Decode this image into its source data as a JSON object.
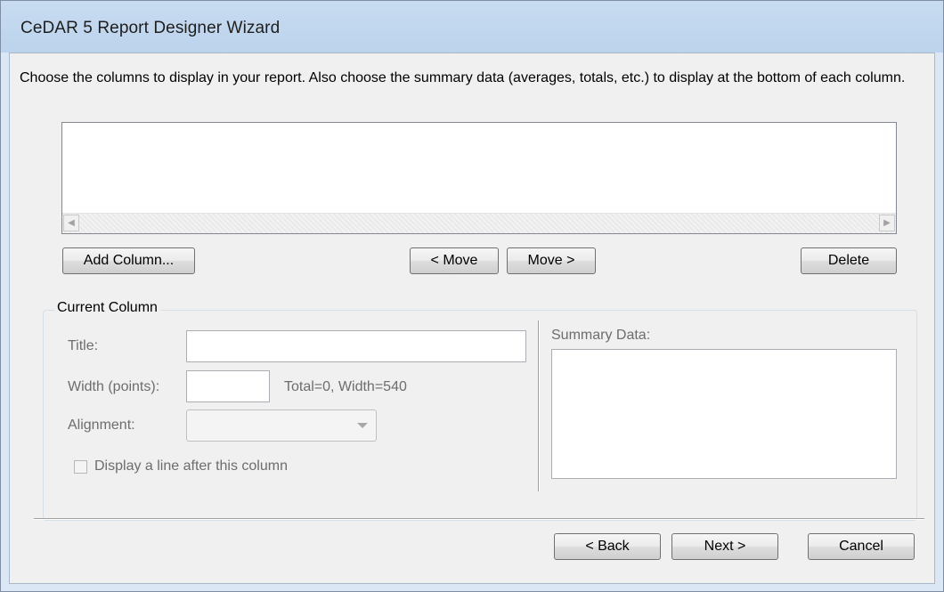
{
  "window": {
    "title": "CeDAR 5 Report Designer Wizard"
  },
  "instructions": "Choose the columns to display in your report. Also choose the summary data (averages, totals, etc.) to display at the bottom of each column.",
  "toolbar": {
    "add_column_label": "Add Column...",
    "move_left_label": "< Move",
    "move_right_label": "Move >",
    "delete_label": "Delete"
  },
  "current_column": {
    "group_label": "Current Column",
    "title_label": "Title:",
    "title_value": "",
    "width_label": "Width (points):",
    "width_value": "",
    "width_info": "Total=0, Width=540",
    "alignment_label": "Alignment:",
    "alignment_value": "",
    "line_after_label": "Display a line after this column",
    "line_after_checked": false,
    "summary_label": "Summary Data:"
  },
  "footer": {
    "back_label": "< Back",
    "next_label": "Next >",
    "cancel_label": "Cancel"
  },
  "colors": {
    "titlebar": "#bcd3ec",
    "dialog_bg": "#f0f0f0",
    "disabled_text": "#6d6d6d"
  }
}
